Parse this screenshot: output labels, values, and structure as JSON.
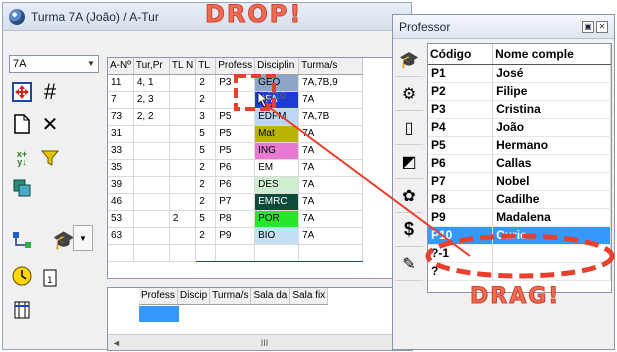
{
  "left_window": {
    "title": "Turma 7A (João) / A-Tur",
    "class_combo": "7A",
    "grid": {
      "columns": [
        "A-Nº",
        "Tur,Pr",
        "TL N",
        "TL",
        "Profess",
        "Disciplin",
        "Turma/s"
      ],
      "rows": [
        [
          "11",
          "4, 1",
          "",
          "2",
          "P3",
          "GEO",
          "7A,7B,9"
        ],
        [
          "7",
          "2, 3",
          "",
          "2",
          "P10",
          "DFA",
          "7A"
        ],
        [
          "73",
          "2, 2",
          "",
          "3",
          "P5",
          "EDFM",
          "7A,7B"
        ],
        [
          "31",
          "",
          "",
          "5",
          "P5",
          "Mat",
          "7A"
        ],
        [
          "33",
          "",
          "",
          "5",
          "P5",
          "ING",
          "7A"
        ],
        [
          "35",
          "",
          "",
          "2",
          "P6",
          "EM",
          "7A"
        ],
        [
          "39",
          "",
          "",
          "2",
          "P6",
          "DES",
          "7A"
        ],
        [
          "46",
          "",
          "",
          "2",
          "P7",
          "EMRC",
          "7A"
        ],
        [
          "53",
          "",
          "2",
          "5",
          "P8",
          "POR",
          "7A"
        ],
        [
          "63",
          "",
          "",
          "2",
          "P9",
          "BIO",
          "7A"
        ]
      ],
      "row_classes": [
        "c-geo",
        "c-dfa",
        "c-edfm",
        "c-mat",
        "c-ing",
        "c-em",
        "c-des",
        "c-emrc",
        "c-por",
        "c-bio"
      ]
    },
    "lower_columns": [
      "Profess",
      "Discip",
      "Turma/s",
      "Sala da",
      "Sala fix"
    ],
    "scroll_marker": "III"
  },
  "right_window": {
    "title": "Professor",
    "columns": [
      "Código",
      "Nome comple"
    ],
    "rows": [
      [
        "P1",
        "José"
      ],
      [
        "P2",
        "Filipe"
      ],
      [
        "P3",
        "Cristina"
      ],
      [
        "P4",
        "João"
      ],
      [
        "P5",
        "Hermano"
      ],
      [
        "P6",
        "Callas"
      ],
      [
        "P7",
        "Nobel"
      ],
      [
        "P8",
        "Cadilhe"
      ],
      [
        "P9",
        "Madalena"
      ],
      [
        "P10",
        "Curie"
      ],
      [
        "?-1",
        ""
      ],
      [
        "?",
        ""
      ]
    ],
    "selected_row": 9
  },
  "annotations": {
    "drop": "DROP!",
    "drag": "DRAG!",
    "drag_ghost": "P10"
  },
  "colors": {
    "accent_selection": "#3399ff",
    "annotation_red": "#e8402c"
  },
  "icons": [
    "move-icon",
    "grid-icon",
    "new-document-icon",
    "delete-icon",
    "sort-icon",
    "filter-icon",
    "copy-icon",
    "link-icon",
    "teacher-icon",
    "clock-icon",
    "calendar-icon",
    "columns-icon",
    "dollar-icon",
    "exit-icon"
  ]
}
